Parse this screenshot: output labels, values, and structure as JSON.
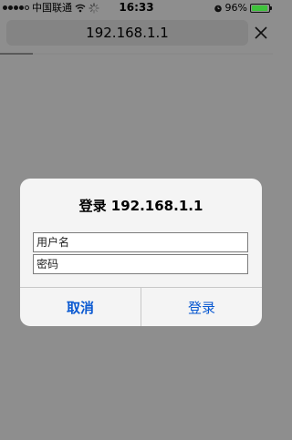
{
  "status_bar": {
    "carrier": "中国联通",
    "time": "16:33",
    "battery_text": "96%",
    "battery_level": 0.96,
    "signal_bars_filled": 4,
    "signal_bars_total": 5,
    "icons": [
      "wifi-icon",
      "activity-spinner-icon",
      "alarm-icon",
      "battery-icon"
    ]
  },
  "address_bar": {
    "url": "192.168.1.1",
    "close_icon": "close-icon",
    "load_progress": 0.12
  },
  "dialog": {
    "title": "登录 192.168.1.1",
    "username_placeholder": "用户名",
    "password_placeholder": "密码",
    "cancel_label": "取消",
    "login_label": "登录"
  },
  "colors": {
    "background": "#8e8e8e",
    "dialog_bg": "#f4f4f4",
    "button_text": "#0a59d1",
    "battery_fill": "#3ec33b"
  }
}
